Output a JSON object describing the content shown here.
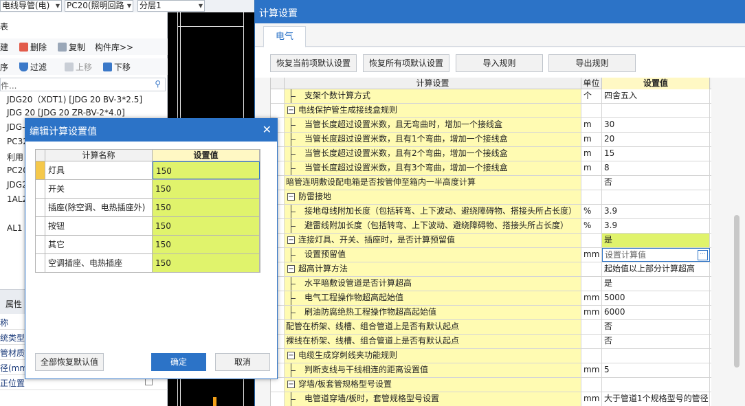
{
  "top_toolbar": {
    "combo1": "电线导管(电)",
    "combo2": "PC20(照明回路",
    "combo3": "分层1"
  },
  "left_panel": {
    "header": "表",
    "toolbar1": {
      "new_label": "建",
      "delete_label": "删除",
      "copy_label": "复制",
      "library_label": "构件库>>"
    },
    "toolbar2": {
      "sort_label": "序",
      "filter_label": "过滤",
      "up_label": "上移",
      "down_label": "下移"
    },
    "search_placeholder": "件...",
    "items": [
      "JDG20（XDT1) [JDG 20 BV-3*2.5]",
      "JDG  20 [JDG 20 ZR-BV-2*4.0]",
      "JDG-",
      "PC32",
      "利用",
      "PC20",
      "JDG2",
      "1AL2",
      "AL1"
    ],
    "props_header": "属性",
    "props": [
      "称",
      "统类型",
      "管材质",
      "径(mm)",
      "正位置"
    ]
  },
  "window": {
    "title": "计算设置",
    "tab": "电气",
    "buttons": {
      "restore_current": "恢复当前项默认设置",
      "restore_all": "恢复所有项默认设置",
      "import": "导入规则",
      "export": "导出规则"
    },
    "columns": {
      "name": "计算设置",
      "unit": "单位",
      "value": "设置值"
    },
    "rows": [
      {
        "level": 1,
        "name": "支架个数计算方式",
        "unit": "个",
        "value": "四舍五入"
      },
      {
        "level": 0,
        "expander": true,
        "name": "电线保护管生成接线盒规则",
        "unit": "",
        "value": ""
      },
      {
        "level": 1,
        "name": "当管长度超过设置米数，且无弯曲时，增加一个接线盒",
        "unit": "m",
        "value": "30"
      },
      {
        "level": 1,
        "name": "当管长度超过设置米数，且有1个弯曲，增加一个接线盒",
        "unit": "m",
        "value": "20"
      },
      {
        "level": 1,
        "name": "当管长度超过设置米数，且有2个弯曲，增加一个接线盒",
        "unit": "m",
        "value": "15"
      },
      {
        "level": 1,
        "name": "当管长度超过设置米数，且有3个弯曲，增加一个接线盒",
        "unit": "m",
        "value": "8"
      },
      {
        "level": 0,
        "name": "暗管连明敷设配电箱是否按管伸至箱内一半高度计算",
        "unit": "",
        "value": "否"
      },
      {
        "level": 0,
        "expander": true,
        "name": "防雷接地",
        "unit": "",
        "value": ""
      },
      {
        "level": 1,
        "name": "接地母线附加长度（包括转弯、上下波动、避绕障碍物、搭接头所占长度）",
        "unit": "%",
        "value": "3.9"
      },
      {
        "level": 1,
        "name": "避雷线附加长度（包括转弯、上下波动、避绕障碍物、搭接头所占长度）",
        "unit": "%",
        "value": "3.9"
      },
      {
        "level": 0,
        "expander": true,
        "name": "连接灯具、开关、插座时，是否计算预留值",
        "unit": "",
        "value": "是",
        "highlight": true
      },
      {
        "level": 1,
        "name": "设置预留值",
        "unit": "mm",
        "value": "设置计算值",
        "editing": true
      },
      {
        "level": 0,
        "expander": true,
        "name": "超高计算方法",
        "unit": "",
        "value": "起始值以上部分计算超高"
      },
      {
        "level": 1,
        "name": "水平暗敷设管道是否计算超高",
        "unit": "",
        "value": "是"
      },
      {
        "level": 1,
        "name": "电气工程操作物超高起始值",
        "unit": "mm",
        "value": "5000"
      },
      {
        "level": 1,
        "name": "刷油防腐绝热工程操作物超高起始值",
        "unit": "mm",
        "value": "6000"
      },
      {
        "level": 0,
        "name": "配管在桥架、线槽、组合管道上是否有默认起点",
        "unit": "",
        "value": "否"
      },
      {
        "level": 0,
        "name": "裸线在桥架、线槽、组合管道上是否有默认起点",
        "unit": "",
        "value": "否"
      },
      {
        "level": 0,
        "expander": true,
        "name": "电缆生成穿刺线夹功能规则",
        "unit": "",
        "value": ""
      },
      {
        "level": 1,
        "name": "判断支线与干线相连的距离设置值",
        "unit": "mm",
        "value": "5"
      },
      {
        "level": 0,
        "expander": true,
        "name": "穿墙/板套管规格型号设置",
        "unit": "",
        "value": ""
      },
      {
        "level": 1,
        "name": "电管道穿墙/板时，套管规格型号设置",
        "unit": "mm",
        "value": "大于管道1个规格型号的管径"
      }
    ]
  },
  "dialog": {
    "title": "编辑计算设置值",
    "columns": {
      "name": "计算名称",
      "value": "设置值"
    },
    "rows": [
      {
        "name": "灯具",
        "value": "150"
      },
      {
        "name": "开关",
        "value": "150"
      },
      {
        "name": "插座(除空调、电热插座外)",
        "value": "150"
      },
      {
        "name": "按钮",
        "value": "150"
      },
      {
        "name": "其它",
        "value": "150"
      },
      {
        "name": "空调插座、电热插座",
        "value": "150"
      }
    ],
    "restore_label": "全部恢复默认值",
    "ok_label": "确定",
    "cancel_label": "取消"
  },
  "colors": {
    "title_blue": "#2c73c7",
    "name_cell_yellow": "#fffbb2",
    "highlight_yellow": "#e0f36c"
  }
}
